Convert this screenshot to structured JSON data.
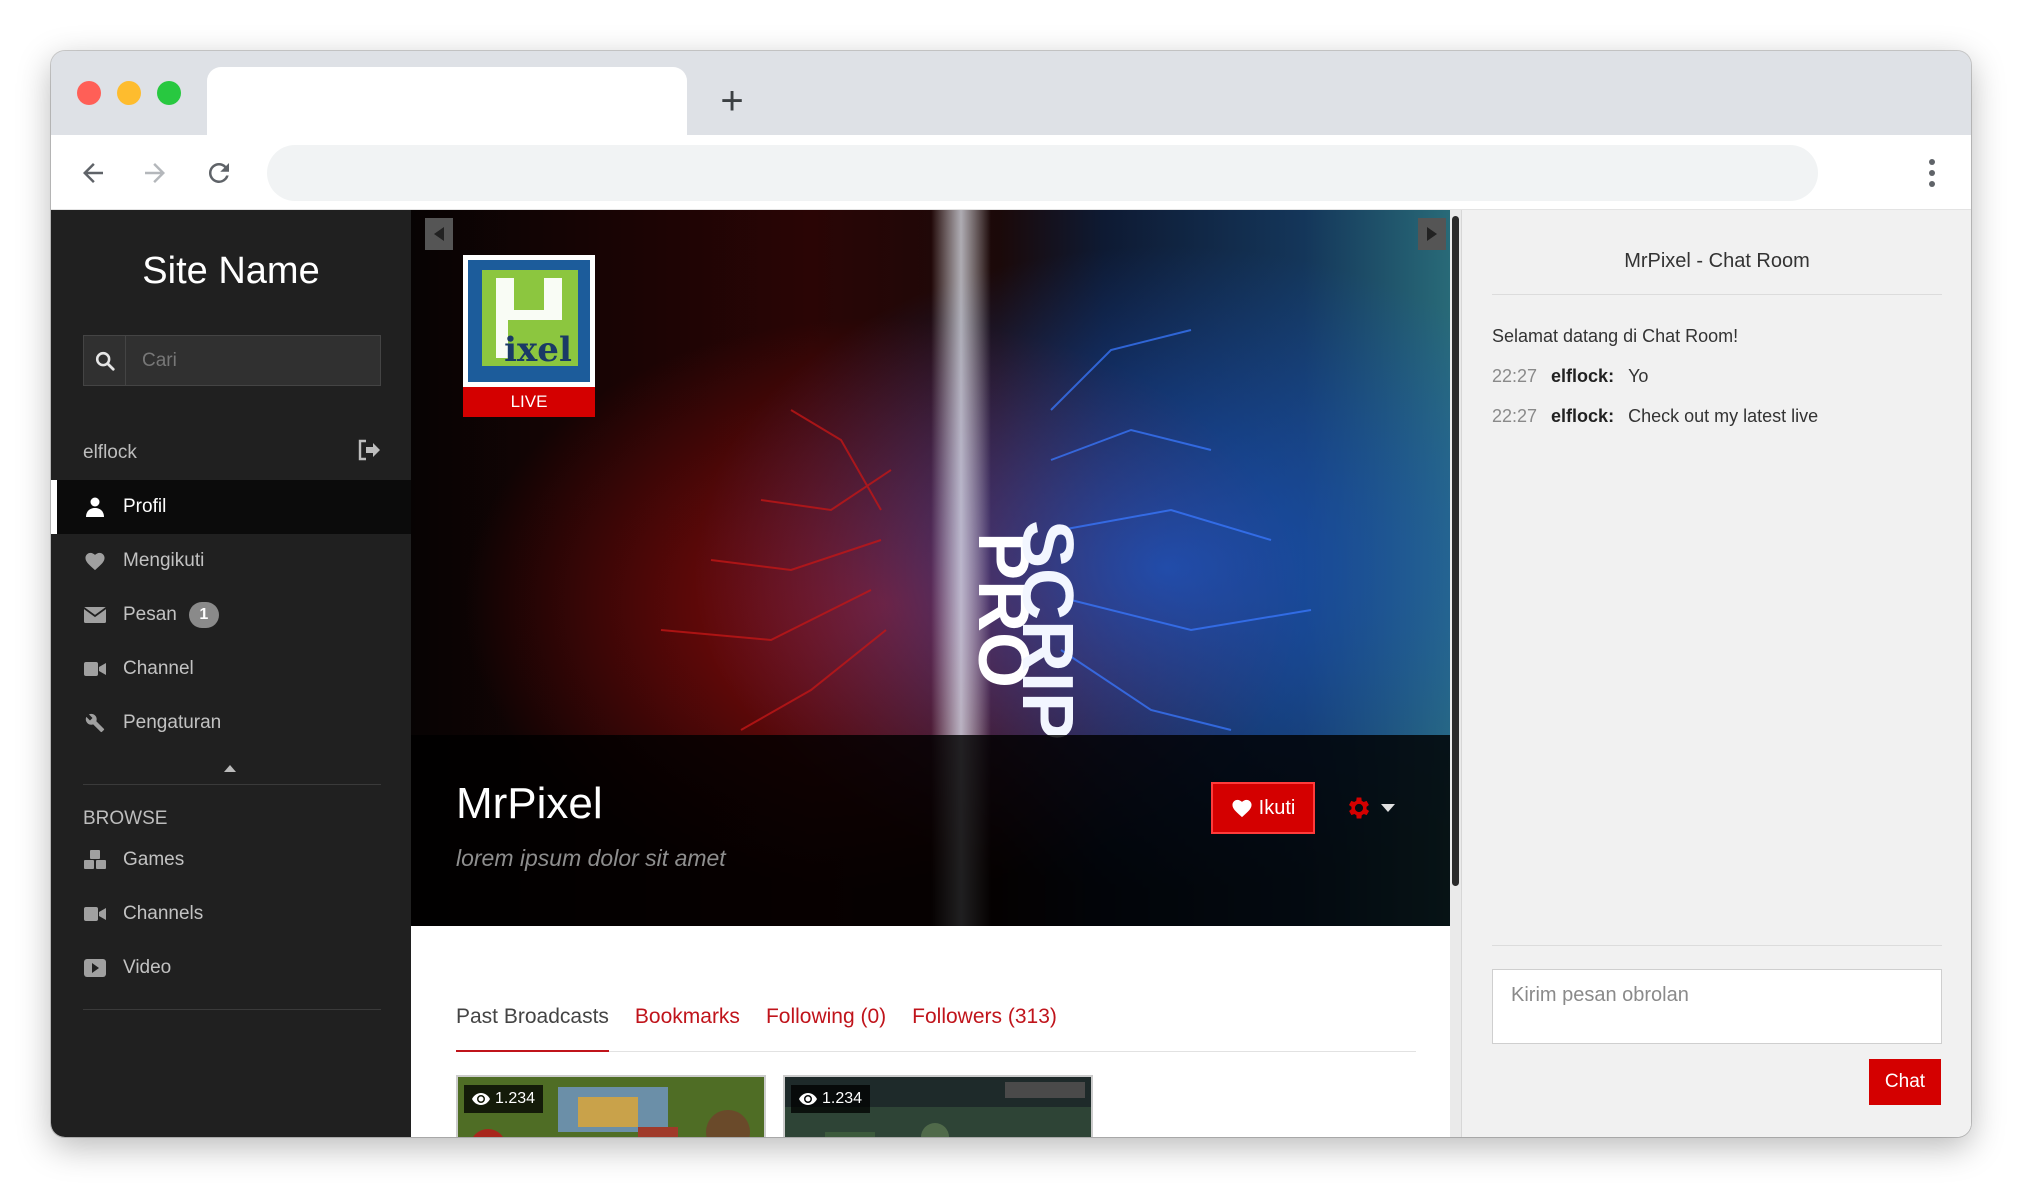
{
  "browser": {
    "new_tab_label": "+"
  },
  "sidebar": {
    "site_name": "Site Name",
    "search_placeholder": "Cari",
    "username": "elflock",
    "nav": [
      {
        "label": "Profil",
        "icon": "user-icon",
        "active": true
      },
      {
        "label": "Mengikuti",
        "icon": "heart-icon"
      },
      {
        "label": "Pesan",
        "icon": "envelope-icon",
        "badge": "1"
      },
      {
        "label": "Channel",
        "icon": "video-camera-icon"
      },
      {
        "label": "Pengaturan",
        "icon": "wrench-icon"
      }
    ],
    "browse_label": "BROWSE",
    "browse": [
      {
        "label": "Games",
        "icon": "cubes-icon"
      },
      {
        "label": "Channels",
        "icon": "video-camera-icon"
      },
      {
        "label": "Video",
        "icon": "play-icon"
      }
    ]
  },
  "channel": {
    "live_label": "LIVE",
    "name": "MrPixel",
    "description": "lorem ipsum dolor sit amet",
    "follow_label": "Ikuti",
    "banner_text_left": "PRO",
    "banner_text_right": "SCRIP"
  },
  "tabs": [
    {
      "label": "Past Broadcasts",
      "active": true
    },
    {
      "label": "Bookmarks"
    },
    {
      "label": "Following (0)"
    },
    {
      "label": "Followers (313)"
    }
  ],
  "videos": [
    {
      "views": "1.234"
    },
    {
      "views": "1.234"
    }
  ],
  "chat": {
    "title": "MrPixel - Chat Room",
    "welcome": "Selamat datang di Chat Room!",
    "messages": [
      {
        "time": "22:27",
        "user": "elflock:",
        "text": "Yo"
      },
      {
        "time": "22:27",
        "user": "elflock:",
        "text": "Check out my latest live"
      }
    ],
    "input_placeholder": "Kirim pesan obrolan",
    "send_label": "Chat"
  },
  "colors": {
    "accent": "#d40000",
    "sidebar_bg": "#202020",
    "chat_bg": "#f1f1f1"
  }
}
